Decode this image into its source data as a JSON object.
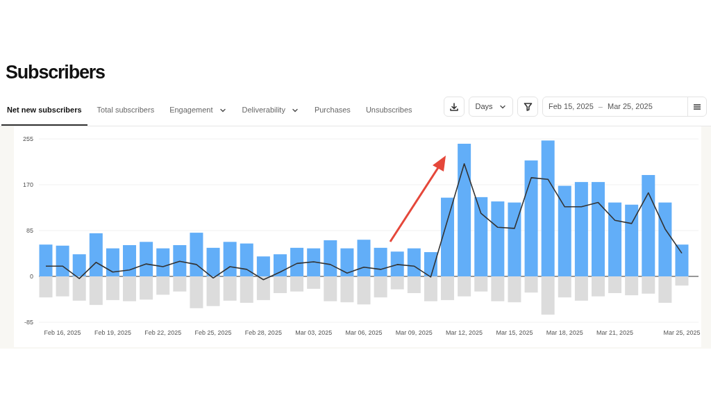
{
  "title": "Subscribers",
  "tabs": [
    {
      "label": "Net new subscribers",
      "selected": true,
      "dropdown": false
    },
    {
      "label": "Total subscribers",
      "selected": false,
      "dropdown": false
    },
    {
      "label": "Engagement",
      "selected": false,
      "dropdown": true
    },
    {
      "label": "Deliverability",
      "selected": false,
      "dropdown": true
    },
    {
      "label": "Purchases",
      "selected": false,
      "dropdown": false
    },
    {
      "label": "Unsubscribes",
      "selected": false,
      "dropdown": false
    }
  ],
  "toolbar": {
    "interval": "Days",
    "date_from": "Feb 15, 2025",
    "date_separator": "–",
    "date_to": "Mar 25, 2025"
  },
  "chart_data": {
    "type": "bar",
    "stacked": true,
    "ylim": [
      -85,
      255
    ],
    "yticks": [
      -85,
      0,
      85,
      170,
      255
    ],
    "categories": [
      null,
      "Feb 16, 2025",
      null,
      null,
      "Feb 19, 2025",
      null,
      null,
      "Feb 22, 2025",
      null,
      null,
      "Feb 25, 2025",
      null,
      null,
      "Feb 28, 2025",
      null,
      null,
      "Mar 03, 2025",
      null,
      null,
      "Mar 06, 2025",
      null,
      null,
      "Mar 09, 2025",
      null,
      null,
      "Mar 12, 2025",
      null,
      null,
      "Mar 15, 2025",
      null,
      null,
      "Mar 18, 2025",
      null,
      null,
      "Mar 21, 2025",
      null,
      null,
      null,
      "Mar 25, 2025"
    ],
    "series": [
      {
        "color": "#62aef8",
        "values": [
          59,
          57,
          41,
          80,
          52,
          58,
          64,
          52,
          58,
          81,
          53,
          64,
          61,
          37,
          41,
          53,
          52,
          67,
          52,
          68,
          53,
          46,
          52,
          45,
          146,
          246,
          147,
          139,
          137,
          215,
          252,
          168,
          175,
          175,
          137,
          133,
          188,
          137,
          59
        ]
      },
      {
        "color": "#dcdcdc",
        "values": [
          -39,
          -37,
          -45,
          -53,
          -44,
          -46,
          -43,
          -34,
          -28,
          -59,
          -55,
          -45,
          -49,
          -44,
          -31,
          -28,
          -23,
          -46,
          -48,
          -52,
          -39,
          -24,
          -31,
          -46,
          -44,
          -37,
          -28,
          -46,
          -48,
          -30,
          -71,
          -39,
          -45,
          -37,
          -31,
          -35,
          -32,
          -49,
          -17
        ]
      },
      {
        "type": "line",
        "color": "#333333",
        "values": [
          19,
          19,
          -4,
          26,
          8,
          12,
          23,
          18,
          28,
          22,
          -3,
          18,
          13,
          -6,
          8,
          24,
          27,
          22,
          6,
          17,
          13,
          22,
          19,
          -1,
          104,
          209,
          117,
          91,
          89,
          183,
          180,
          129,
          129,
          137,
          104,
          98,
          155,
          88,
          43
        ]
      }
    ]
  }
}
